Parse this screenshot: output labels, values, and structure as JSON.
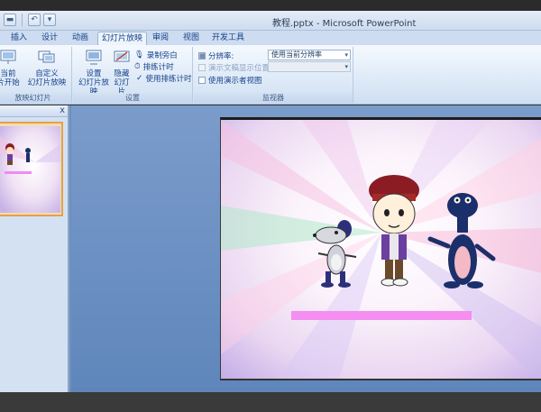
{
  "window": {
    "title": "教程.pptx - Microsoft PowerPoint"
  },
  "qat": {
    "save_icon": "save-icon",
    "undo_icon": "undo-icon",
    "dropdown_icon": "qat-dropdown-icon"
  },
  "tabs": [
    {
      "label": "插入"
    },
    {
      "label": "设计"
    },
    {
      "label": "动画"
    },
    {
      "label": "幻灯片放映",
      "active": true
    },
    {
      "label": "审阅"
    },
    {
      "label": "视图"
    },
    {
      "label": "开发工具"
    }
  ],
  "ribbon": {
    "start": {
      "from_current_line1": "当前",
      "from_current_line2": "片开始",
      "group_label": "放映幻灯片"
    },
    "custom_show": {
      "line1": "自定义",
      "line2": "幻灯片放映"
    },
    "setup": {
      "setup_line1": "设置",
      "setup_line2": "幻灯片放映",
      "hide_line1": "隐藏",
      "hide_line2": "幻灯片",
      "record_narration": "录制旁白",
      "rehearse_timings": "排练计时",
      "use_rehearsed": "使用排练计时",
      "group_label": "设置"
    },
    "monitors": {
      "resolution_label": "分辨率:",
      "resolution_value": "使用当前分辨率",
      "show_on_label": "演示文稿显示位置:",
      "presenter_view": "使用演示者视图",
      "group_label": "监视器"
    }
  },
  "pane": {
    "close": "x"
  },
  "colors": {
    "accent": "#e5a04a",
    "ribbon": "#dfeaf7",
    "workspace": "#6d8fbd"
  }
}
